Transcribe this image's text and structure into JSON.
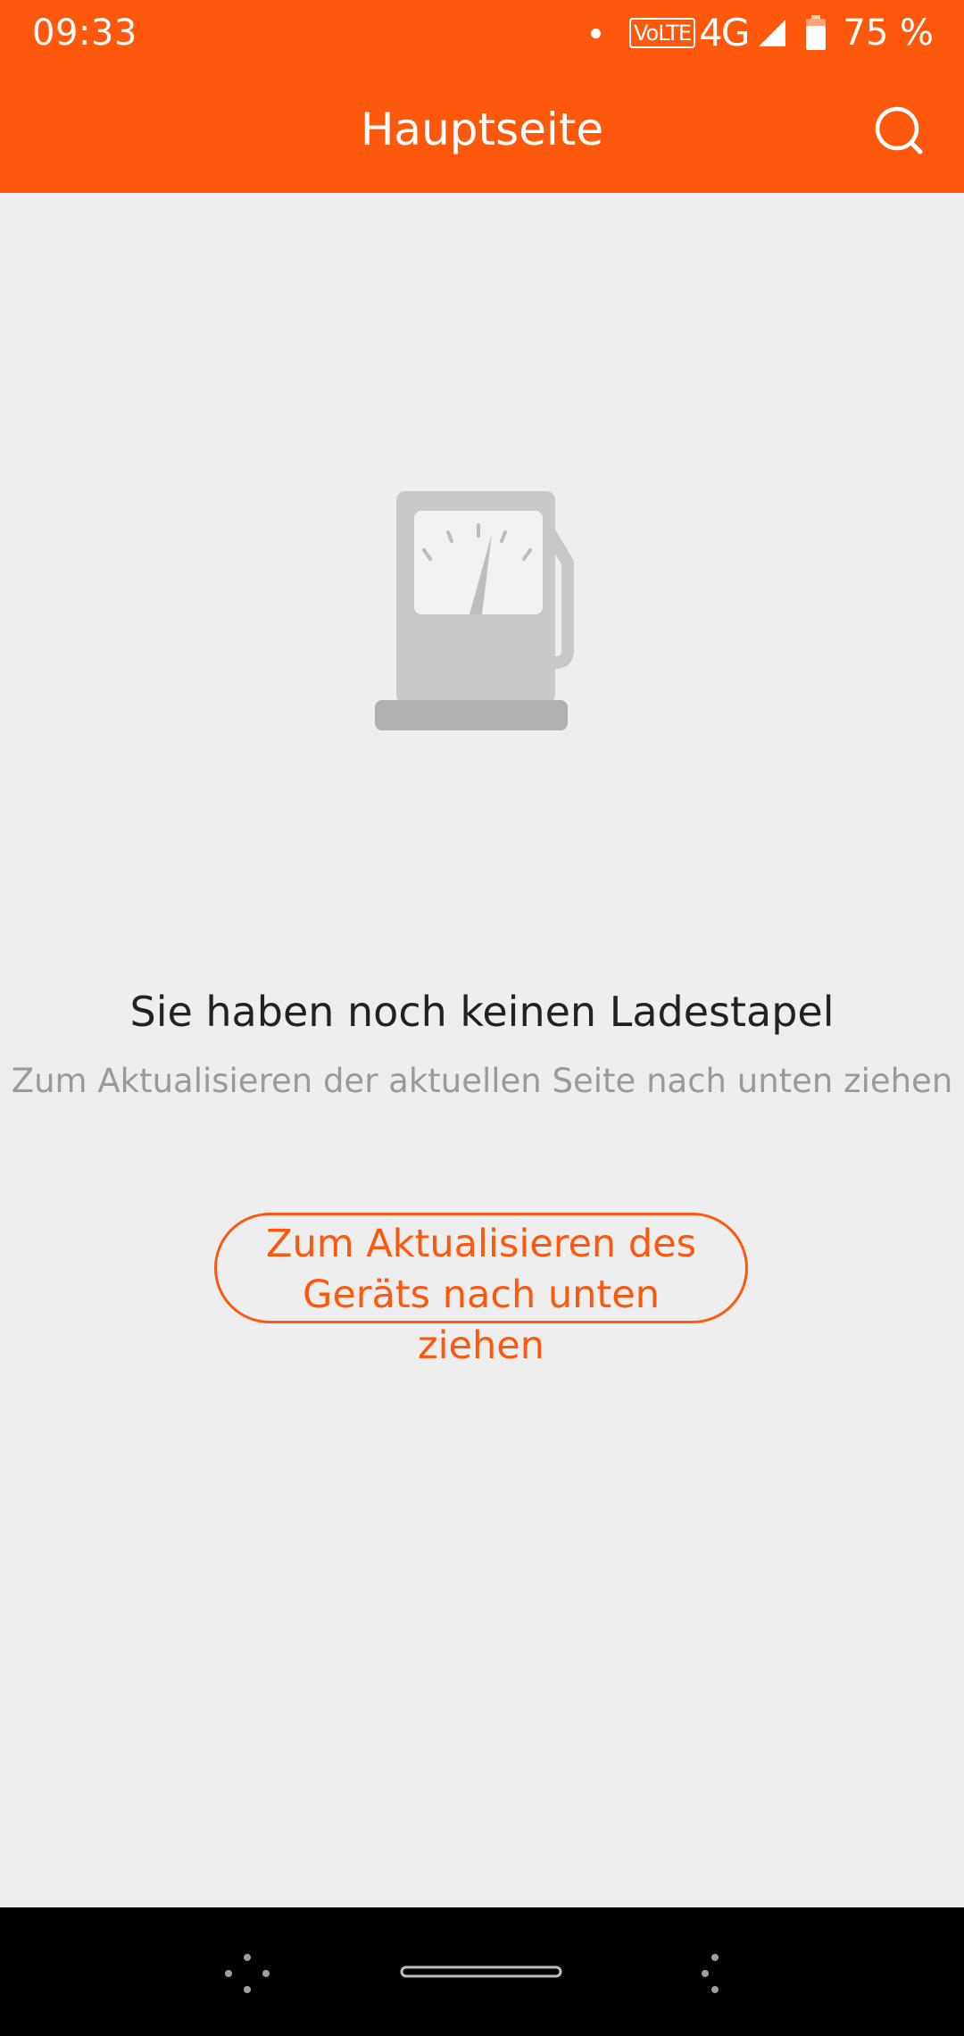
{
  "status_bar": {
    "time": "09:33",
    "volte": "VoLTE",
    "network": "4G",
    "battery": "75 %"
  },
  "app_bar": {
    "title": "Hauptseite",
    "search_icon": "search-icon"
  },
  "empty_state": {
    "illustration": "charging-station-icon",
    "title": "Sie haben noch keinen Ladestapel",
    "hint": "Zum Aktualisieren der aktuellen Seite nach unten ziehen",
    "button_label": "Zum Aktualisieren des Geräts nach unten ziehen"
  },
  "nav_bar": {
    "left_icon": "nav-dots-icon",
    "home_icon": "home-bar-icon",
    "right_icon": "nav-dots-icon"
  },
  "colors": {
    "accent": "#fd580c",
    "background": "#eeeeee",
    "title_text": "#222222",
    "hint_text": "#9a9a9a",
    "illustration": "#c8c8c8"
  }
}
